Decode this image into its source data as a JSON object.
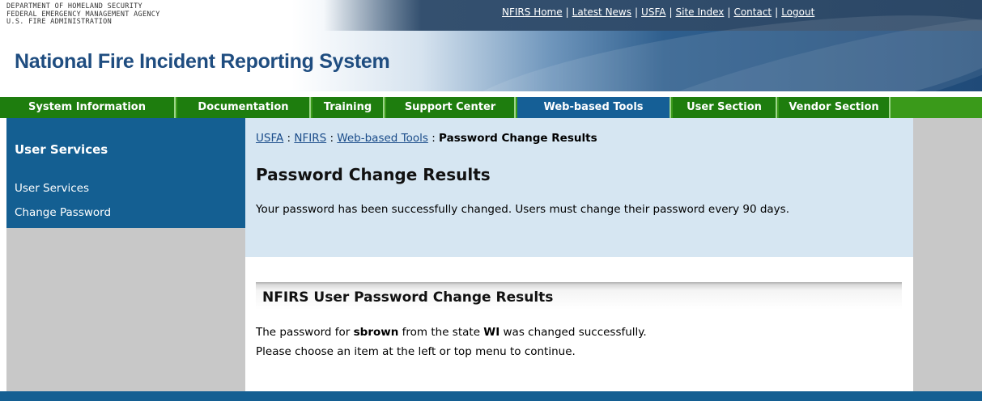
{
  "header": {
    "agency_lines": [
      "DEPARTMENT OF HOMELAND SECURITY",
      "FEDERAL EMERGENCY MANAGEMENT AGENCY",
      "U.S. FIRE ADMINISTRATION"
    ],
    "site_title": "National Fire Incident Reporting System",
    "top_links": [
      "NFIRS Home",
      "Latest News",
      "USFA",
      "Site Index",
      "Contact",
      "Logout"
    ]
  },
  "nav": {
    "items": [
      "System Information",
      "Documentation",
      "Training",
      "Support Center",
      "Web-based Tools",
      "User Section",
      "Vendor Section"
    ],
    "active": "Web-based Tools"
  },
  "sidebar": {
    "heading": "User Services",
    "links": [
      "User Services",
      "Change Password"
    ]
  },
  "main": {
    "breadcrumb": {
      "links": [
        "USFA",
        "NFIRS",
        "Web-based Tools"
      ],
      "separator": " : ",
      "current": "Password Change Results"
    },
    "title": "Password Change Results",
    "message": "Your password has been successfully changed. Users must change their password every 90 days.",
    "section_title": "NFIRS User Password Change Results",
    "result": {
      "prefix": "The password for ",
      "username": "sbrown",
      "middle": " from the state ",
      "state": "WI",
      "suffix": " was changed successfully."
    },
    "instruction": "Please choose an item at the left or top menu to continue."
  },
  "colors": {
    "nav_green": "#1e7d0e",
    "nav_active_blue": "#155f96",
    "sidebar_blue": "#145f92",
    "panel_light_blue": "#d6e6f2",
    "title_blue": "#1f4d80"
  }
}
